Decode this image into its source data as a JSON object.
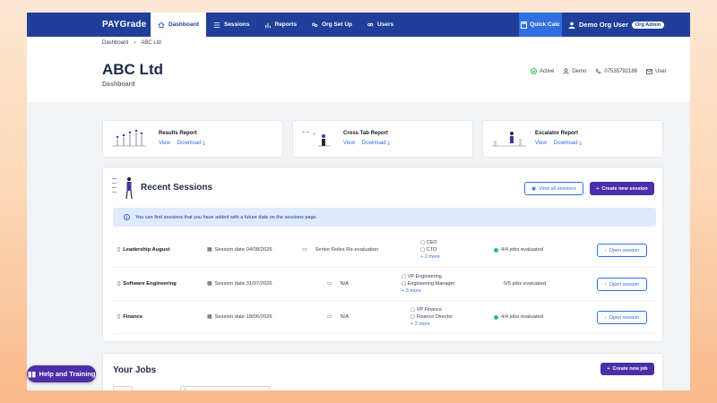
{
  "nav": {
    "logo": "PAYGrade",
    "items": [
      {
        "label": "Dashboard",
        "icon": "home-icon",
        "active": true
      },
      {
        "label": "Sessions",
        "icon": "list-icon"
      },
      {
        "label": "Reports",
        "icon": "chart-icon"
      },
      {
        "label": "Org Set Up",
        "icon": "org-icon"
      },
      {
        "label": "Users",
        "icon": "users-icon"
      }
    ],
    "quick_calc": "Quick Calc",
    "user_name": "Demo Org User",
    "user_role": "Org Admin"
  },
  "breadcrumb": {
    "root": "Dashboard",
    "sep": "›",
    "current": "ABC Ltd"
  },
  "page": {
    "title": "ABC Ltd",
    "subtitle": "Dashboard"
  },
  "meta": {
    "status": "Active",
    "org": "Demo",
    "phone": "07535792186",
    "user": "User"
  },
  "reports": [
    {
      "title": "Results Report",
      "view": "View",
      "download": "Download"
    },
    {
      "title": "Cross Tab Report",
      "view": "View",
      "download": "Download"
    },
    {
      "title": "Escalator Report",
      "view": "View",
      "download": "Download"
    }
  ],
  "sessions": {
    "title": "Recent Sessions",
    "view_all": "View all sessions",
    "create": "Create new session",
    "info": "You can find sessions that you have added with a future date on the sessions page.",
    "rows": [
      {
        "name": "Leadership August",
        "date": "Session date 04/08/2026",
        "desc": "Senior Roles Re-evaluation",
        "jobs": [
          "CEO",
          "CTO"
        ],
        "more": "2 more",
        "evaluated": "4/4 jobs evaluated",
        "complete": true,
        "open": "Open session"
      },
      {
        "name": "Software Engineering",
        "date": "Session date 31/07/2026",
        "desc": "N/A",
        "jobs": [
          "VP Engineering",
          "Engineering Manager"
        ],
        "more": "3 more",
        "evaluated": "0/5 jobs evaluated",
        "complete": false,
        "open": "Open session"
      },
      {
        "name": "Finance",
        "date": "Session date 18/06/2026",
        "desc": "N/A",
        "jobs": [
          "VP Finance",
          "Finance Director"
        ],
        "more": "2 more",
        "evaluated": "4/4 jobs evaluated",
        "complete": true,
        "open": "Open session"
      }
    ]
  },
  "jobs": {
    "title": "Your Jobs",
    "create": "Create new job"
  },
  "help": "Help and Training",
  "colors": {
    "nav": "#1f3f9a",
    "accent": "#2f6fe0",
    "primary_button": "#4b2fa8",
    "success": "#22c55e"
  }
}
